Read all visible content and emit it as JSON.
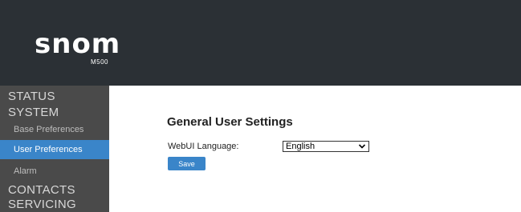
{
  "brand": {
    "logo_word": "snom",
    "model": "M500"
  },
  "sidebar": {
    "items": [
      {
        "label": "STATUS"
      },
      {
        "label": "SYSTEM"
      },
      {
        "label": "Base Preferences"
      },
      {
        "label": "User Preferences",
        "active": true
      },
      {
        "label": "Alarm"
      },
      {
        "label": "CONTACTS"
      },
      {
        "label": "SERVICING"
      }
    ]
  },
  "main": {
    "title": "General User Settings",
    "language": {
      "label": "WebUI Language:",
      "value": "English"
    },
    "save_label": "Save"
  },
  "colors": {
    "header": "#2b3035",
    "sidebar": "#4a4a4a",
    "accent": "#3a85c9"
  }
}
